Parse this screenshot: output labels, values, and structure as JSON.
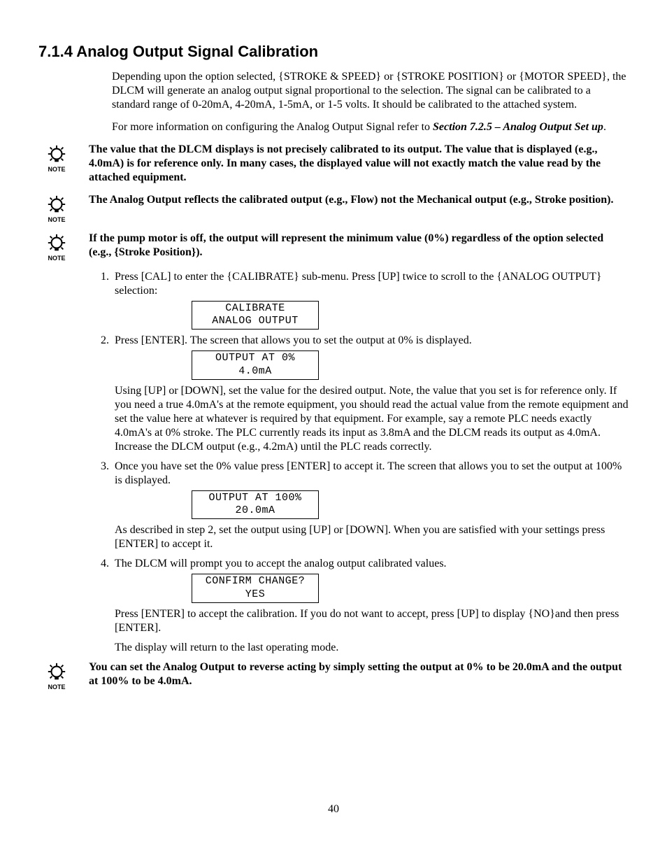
{
  "heading": "7.1.4 Analog Output Signal Calibration",
  "intro1": "Depending upon the option selected, {STROKE & SPEED} or {STROKE POSITION} or {MOTOR SPEED}, the DLCM will generate an analog output signal proportional to the selection.  The signal can be calibrated to a standard range of 0-20mA, 4-20mA, 1-5mA, or 1-5 volts.  It should be calibrated to the attached system.",
  "intro2a": "For more information on configuring the Analog Output Signal refer to ",
  "intro2ref": "Section 7.2.5 – Analog Output Set up",
  "intro2b": ".",
  "note1": "The value that the DLCM displays is not precisely calibrated to its output.  The value that is displayed (e.g., 4.0mA) is for reference only.  In many cases, the displayed value will not exactly match the value read by the attached equipment.",
  "note2": "The Analog Output reflects the calibrated output (e.g., Flow) not the Mechanical output (e.g., Stroke position).",
  "note3": "If the pump motor is off, the output will represent the minimum value (0%) regardless of the option selected (e.g., {Stroke Position}).",
  "note4": "You can set the Analog Output to reverse acting by simply setting the output at 0% to be 20.0mA and the output at 100% to be 4.0mA.",
  "note_label": "NOTE",
  "step1_text": "Press [CAL] to enter the {CALIBRATE} sub-menu.  Press [UP] twice to scroll to the {ANALOG OUTPUT} selection:",
  "lcd1_l1": "CALIBRATE",
  "lcd1_l2": "ANALOG OUTPUT",
  "step2_text": "Press [ENTER].  The screen that allows you to set the output at 0% is displayed.",
  "lcd2_l1": "OUTPUT AT 0%",
  "lcd2_l2": "4.0mA",
  "step2_after": "Using [UP] or [DOWN], set the value for the desired output.  Note, the value that you set is for reference only.  If you need a true 4.0mA's at the remote equipment, you should read the actual value from the remote equipment and set the value here at whatever is required by that equipment.  For example, say a remote PLC needs exactly 4.0mA's at  0% stroke.  The PLC currently reads its input as 3.8mA and the DLCM reads its output as 4.0mA.  Increase the DLCM output (e.g., 4.2mA) until the PLC reads correctly.",
  "step3_text": "Once you have set the 0% value press [ENTER] to accept it.  The screen that allows you to set the output at 100% is displayed.",
  "lcd3_l1": "OUTPUT AT 100%",
  "lcd3_l2": "20.0mA",
  "step3_after": "As described in step 2, set the output using [UP] or [DOWN].  When you are satisfied with your settings press [ENTER] to accept it.",
  "step4_text": "The DLCM will prompt you to accept the analog output calibrated values.",
  "lcd4_l1": "CONFIRM CHANGE?",
  "lcd4_l2": "YES",
  "step4_after1": "Press [ENTER] to accept the calibration.  If you do not want to accept, press [UP] to display {NO}and then press [ENTER].",
  "step4_after2": "The display will return to the last operating mode.",
  "page_number": "40"
}
